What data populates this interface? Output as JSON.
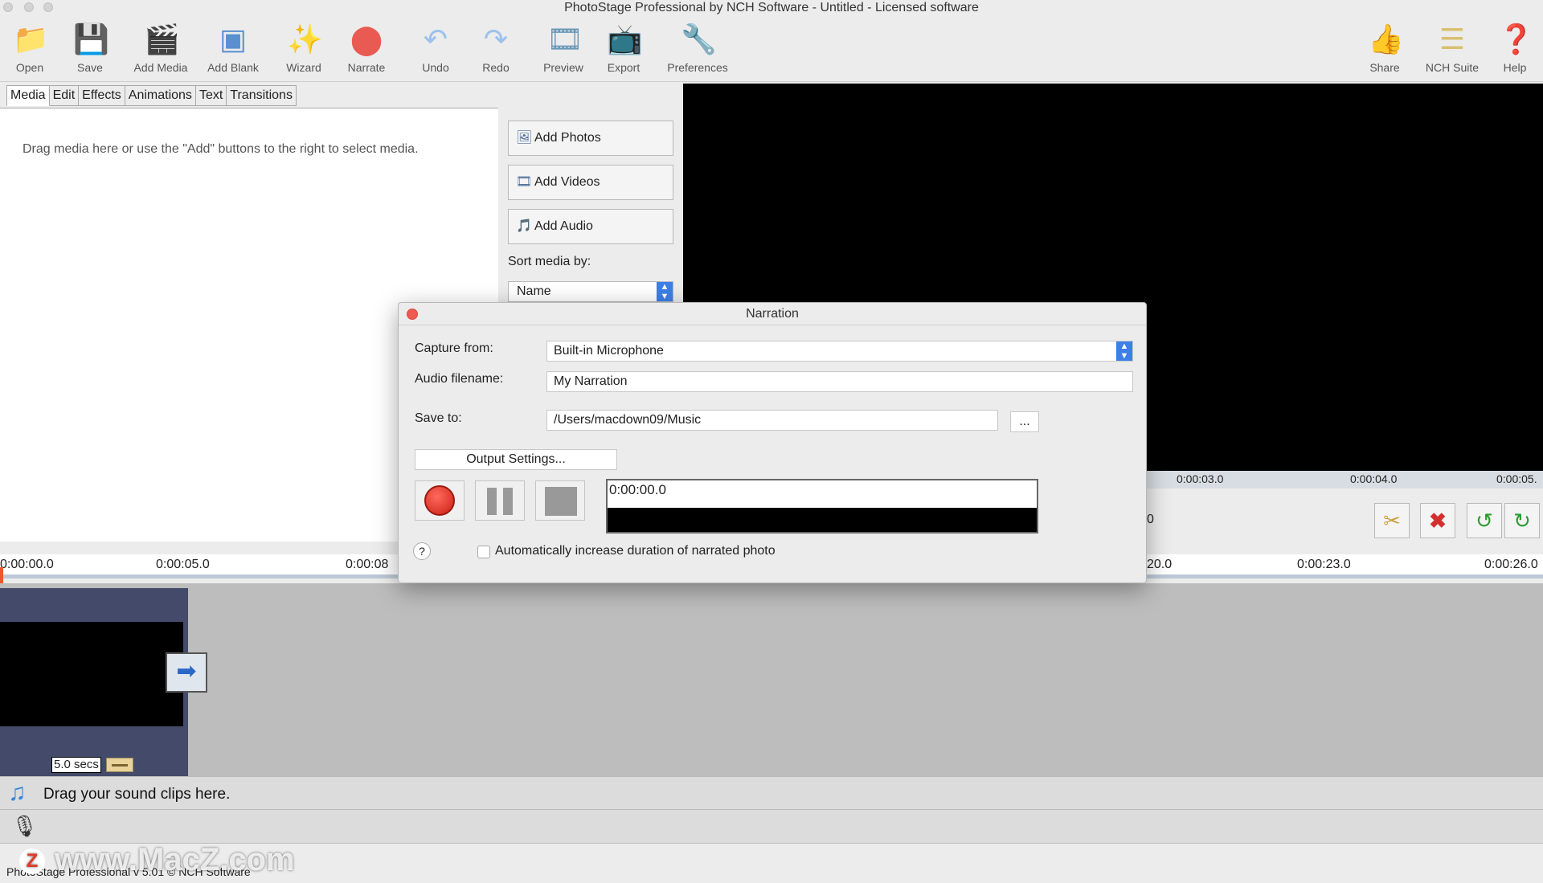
{
  "window": {
    "title": "PhotoStage Professional by NCH Software - Untitled - Licensed software"
  },
  "toolbar": {
    "items": [
      {
        "label": "Open",
        "icon": "folder-icon"
      },
      {
        "label": "Save",
        "icon": "save-icon"
      },
      {
        "label": "Add Media",
        "icon": "add-media-icon"
      },
      {
        "label": "Add Blank",
        "icon": "add-blank-icon"
      },
      {
        "label": "Wizard",
        "icon": "wizard-icon"
      },
      {
        "label": "Narrate",
        "icon": "narrate-icon"
      },
      {
        "label": "Undo",
        "icon": "undo-icon"
      },
      {
        "label": "Redo",
        "icon": "redo-icon"
      },
      {
        "label": "Preview",
        "icon": "preview-icon"
      },
      {
        "label": "Export",
        "icon": "export-icon"
      },
      {
        "label": "Preferences",
        "icon": "preferences-icon"
      }
    ],
    "right_items": [
      {
        "label": "Share",
        "icon": "share-icon"
      },
      {
        "label": "NCH Suite",
        "icon": "nch-suite-icon"
      },
      {
        "label": "Help",
        "icon": "help-icon"
      }
    ]
  },
  "tabs": [
    "Media",
    "Edit",
    "Effects",
    "Animations",
    "Text",
    "Transitions"
  ],
  "media": {
    "hint": "Drag media here or use the \"Add\" buttons to the right to select media.",
    "add_photos": "Add Photos",
    "add_videos": "Add Videos",
    "add_audio": "Add Audio",
    "sort_label": "Sort media by:",
    "sort_value": "Name"
  },
  "preview_ruler": [
    "0:00:03.0",
    "0:00:04.0",
    "0:00:05."
  ],
  "preview_controls": {
    "partial_time": "0"
  },
  "timeline": {
    "ruler_left": [
      "0:00:00.0",
      "0:00:05.0",
      "0:00:08"
    ],
    "ruler_right": [
      "20.0",
      "0:00:23.0",
      "0:00:26.0"
    ],
    "clip_duration": "5.0 secs",
    "sound_hint": "Drag your sound clips here."
  },
  "status": {
    "text": "PhotoStage Professional v 5.01 © NCH Software"
  },
  "watermark": {
    "letter": "Z",
    "text": "www.MacZ.com"
  },
  "narration_dialog": {
    "title": "Narration",
    "capture_label": "Capture from:",
    "capture_value": "Built-in Microphone",
    "filename_label": "Audio filename:",
    "filename_value": "My Narration",
    "saveto_label": "Save to:",
    "saveto_value": "/Users/macdown09/Music",
    "browse_label": "...",
    "output_settings": "Output Settings...",
    "time": "0:00:00.0",
    "help": "?",
    "auto_increase": "Automatically increase duration of narrated photo"
  }
}
